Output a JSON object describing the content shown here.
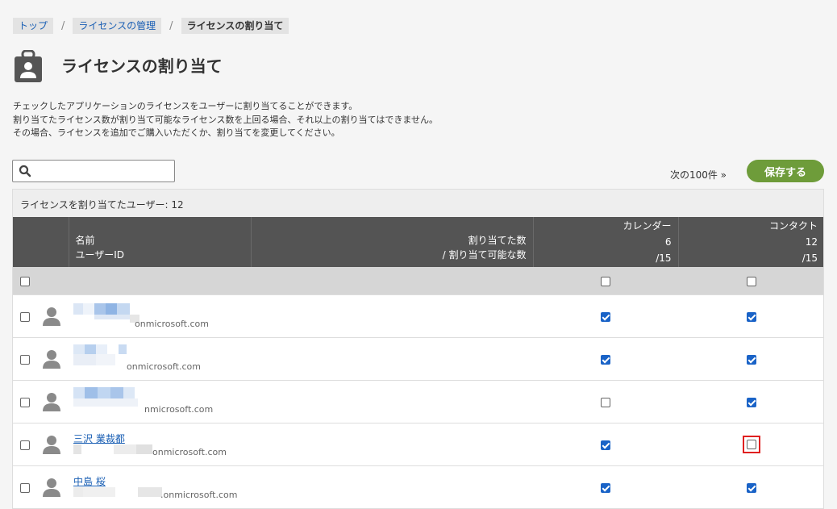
{
  "breadcrumb": {
    "items": [
      {
        "label": "トップ"
      },
      {
        "label": "ライセンスの管理"
      },
      {
        "label": "ライセンスの割り当て"
      }
    ],
    "separator": "/"
  },
  "page": {
    "title": "ライセンスの割り当て",
    "description": [
      "チェックしたアプリケーションのライセンスをユーザーに割り当てることができます。",
      "割り当てたライセンス数が割り当て可能なライセンス数を上回る場合、それ以上の割り当てはできません。",
      "その場合、ライセンスを追加でご購入いただくか、割り当てを変更してください。"
    ]
  },
  "search": {
    "value": "",
    "placeholder": ""
  },
  "toolbar": {
    "next_label": "次の100件 »",
    "save_label": "保存する"
  },
  "summary": {
    "assigned_label": "ライセンスを割り当てたユーザー: 12"
  },
  "table": {
    "headers": {
      "name": "名前",
      "user_id": "ユーザーID",
      "ratio_top": "割り当てた数",
      "ratio_bottom": "/ 割り当て可能な数"
    },
    "apps": [
      {
        "name": "カレンダー",
        "assigned": "6",
        "available": "/15"
      },
      {
        "name": "コンタクト",
        "assigned": "12",
        "available": "/15"
      }
    ],
    "rows": [
      {
        "name": "",
        "user_id": "onmicrosoft.com",
        "calendar": true,
        "contact": true
      },
      {
        "name": "",
        "user_id": "onmicrosoft.com",
        "calendar": true,
        "contact": true
      },
      {
        "name": "",
        "user_id": "nmicrosoft.com",
        "calendar": false,
        "contact": true
      },
      {
        "name": "三沢 業裁都",
        "user_id": "onmicrosoft.com",
        "calendar": true,
        "contact": false
      },
      {
        "name": "中島 桜",
        "user_id": ".onmicrosoft.com",
        "calendar": true,
        "contact": true
      }
    ]
  },
  "colors": {
    "save_button": "#6e9c3a",
    "header_bg": "#545454",
    "checkbox_checked": "#1a63c7",
    "highlight": "#e02020",
    "link": "#1a5fb4"
  },
  "icons": {
    "title": "license-bag-icon",
    "search": "search-icon",
    "avatar": "user-avatar-icon"
  }
}
